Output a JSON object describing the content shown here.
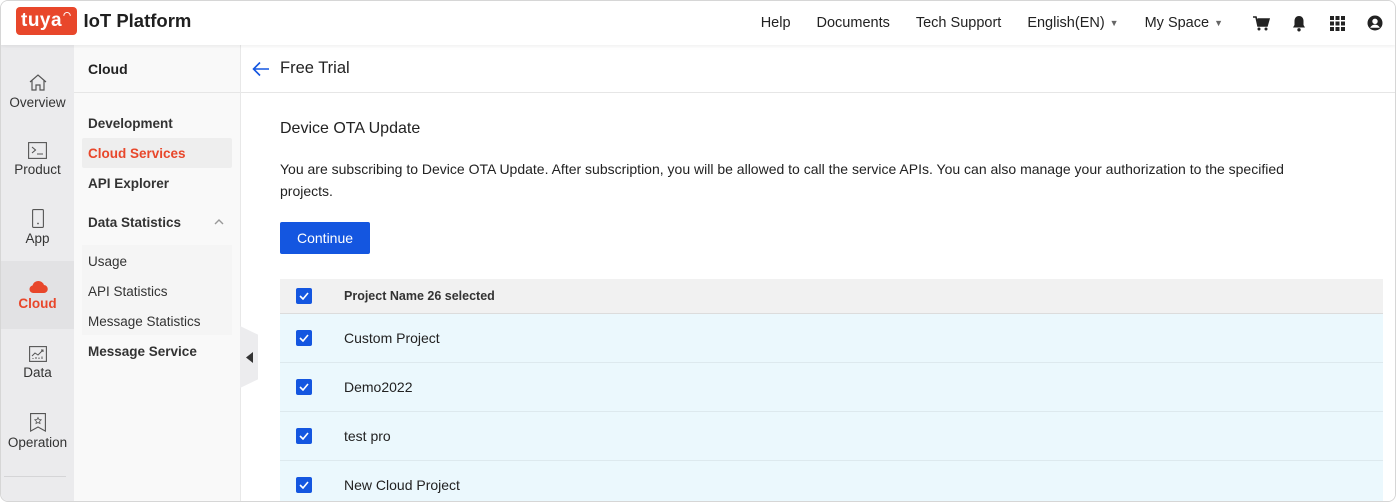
{
  "app": {
    "logo_text": "tuya",
    "title": "IoT Platform",
    "brand_color": "#e8472b",
    "primary_color": "#1456e0"
  },
  "header": {
    "links": [
      {
        "label": "Help"
      },
      {
        "label": "Documents"
      },
      {
        "label": "Tech Support"
      },
      {
        "label": "English(EN)",
        "dropdown": true
      },
      {
        "label": "My Space",
        "dropdown": true
      }
    ],
    "icons": [
      "cart-icon",
      "bell-icon",
      "apps-grid-icon",
      "user-account-icon"
    ]
  },
  "rail": {
    "items": [
      {
        "label": "Overview",
        "icon": "home-icon",
        "active": false
      },
      {
        "label": "Product",
        "icon": "terminal-icon",
        "active": false
      },
      {
        "label": "App",
        "icon": "phone-icon",
        "active": false
      },
      {
        "label": "Cloud",
        "icon": "cloud-icon",
        "active": true
      },
      {
        "label": "Data",
        "icon": "chart-icon",
        "active": false
      },
      {
        "label": "Operation",
        "icon": "bookmark-star-icon",
        "active": false
      }
    ]
  },
  "subnav": {
    "title": "Cloud",
    "items": [
      {
        "label": "Development"
      },
      {
        "label": "Cloud Services",
        "active": true
      },
      {
        "label": "API Explorer"
      }
    ],
    "group": {
      "label": "Data Statistics",
      "expanded": true,
      "items": [
        {
          "label": "Usage"
        },
        {
          "label": "API Statistics"
        },
        {
          "label": "Message Statistics"
        }
      ]
    },
    "extra_item": {
      "label": "Message Service"
    }
  },
  "main": {
    "page_title": "Free Trial",
    "section_title": "Device OTA Update",
    "description": "You are subscribing to Device OTA Update. After subscription, you will be allowed to call the service APIs. You can also manage your authorization to the specified projects.",
    "continue_label": "Continue",
    "table": {
      "header_label": "Project Name 26 selected",
      "header_checked": true,
      "rows": [
        {
          "name": "Custom Project",
          "checked": true
        },
        {
          "name": "Demo2022",
          "checked": true
        },
        {
          "name": "test pro",
          "checked": true
        },
        {
          "name": "New Cloud Project",
          "checked": true
        }
      ]
    }
  }
}
